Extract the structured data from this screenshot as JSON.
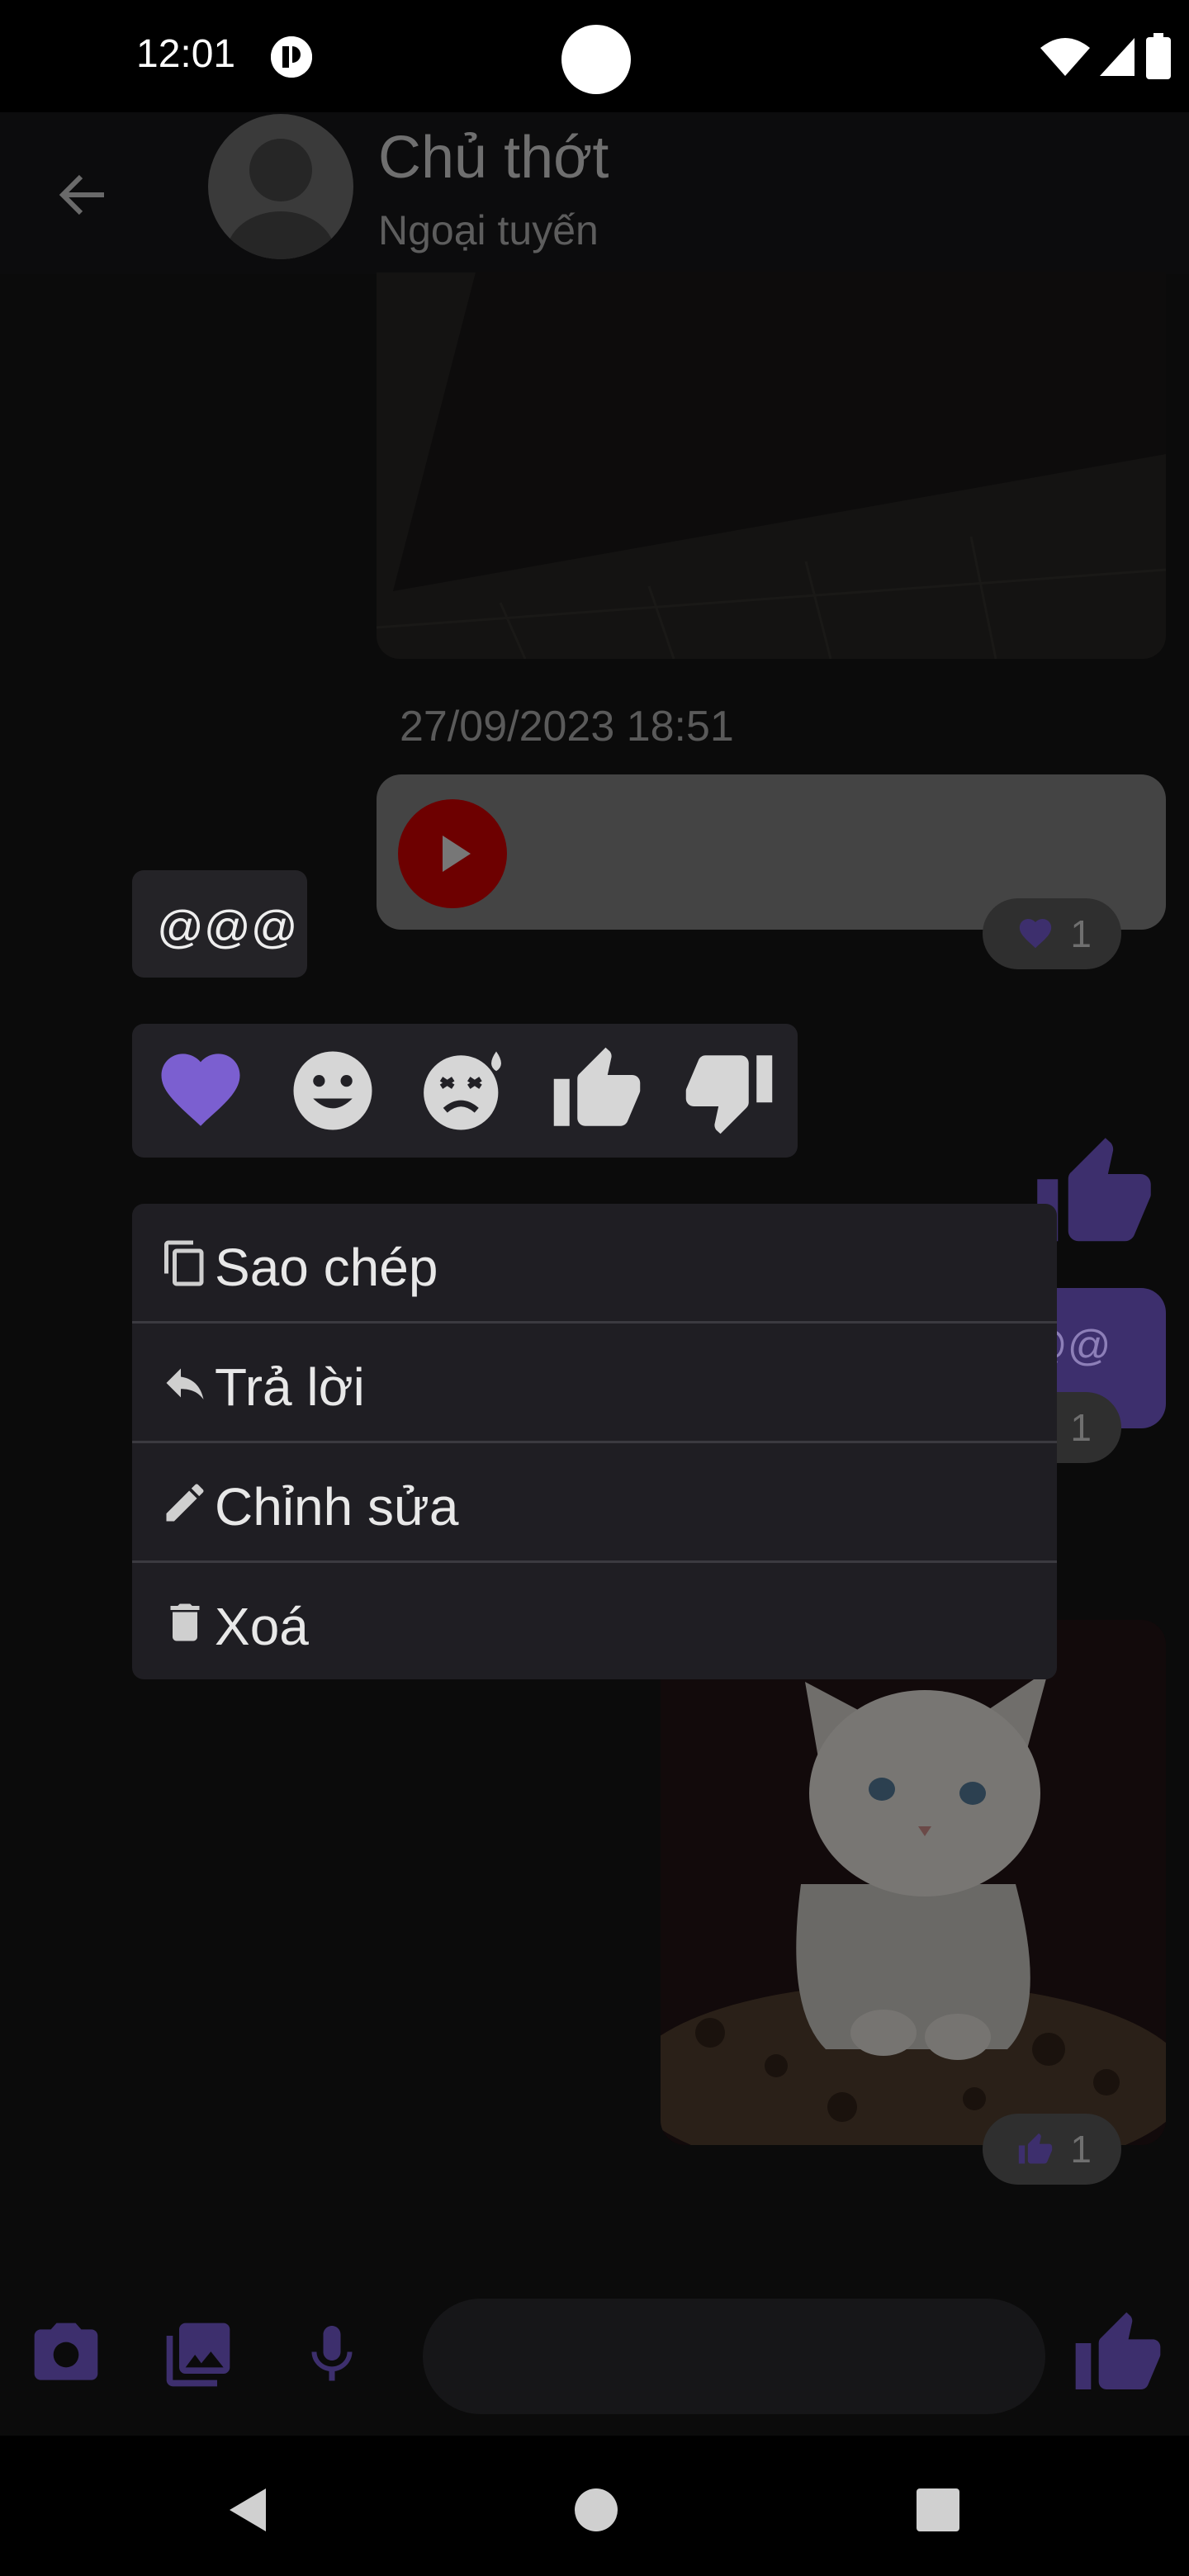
{
  "status_bar": {
    "time": "12:01"
  },
  "header": {
    "contact_name": "Chủ thớt",
    "contact_status": "Ngoại tuyến"
  },
  "chat": {
    "timestamp": "27/09/2023 18:51",
    "audio_reaction": {
      "icon": "heart-icon",
      "count": "1"
    },
    "selected_message": "@@@",
    "purple_message_fragment": "@@",
    "purple_reaction_count": "1",
    "cat_reaction": {
      "icon": "thumbs-up-icon",
      "count": "1"
    }
  },
  "reactions": [
    "heart-icon",
    "smile-icon",
    "sad-sweat-icon",
    "thumbs-up-icon",
    "thumbs-down-icon"
  ],
  "context_menu": {
    "items": [
      {
        "label": "Sao chép",
        "icon": "copy-icon"
      },
      {
        "label": "Trả lời",
        "icon": "reply-icon"
      },
      {
        "label": "Chỉnh sửa",
        "icon": "edit-icon"
      },
      {
        "label": "Xoá",
        "icon": "delete-icon"
      }
    ]
  },
  "input_bar": {
    "placeholder": ""
  },
  "colors": {
    "accent": "#7b5fd0",
    "accent_dim": "#3d2f6d",
    "menu_bg": "#1f1e23",
    "scrim": "#0b0b0b"
  }
}
